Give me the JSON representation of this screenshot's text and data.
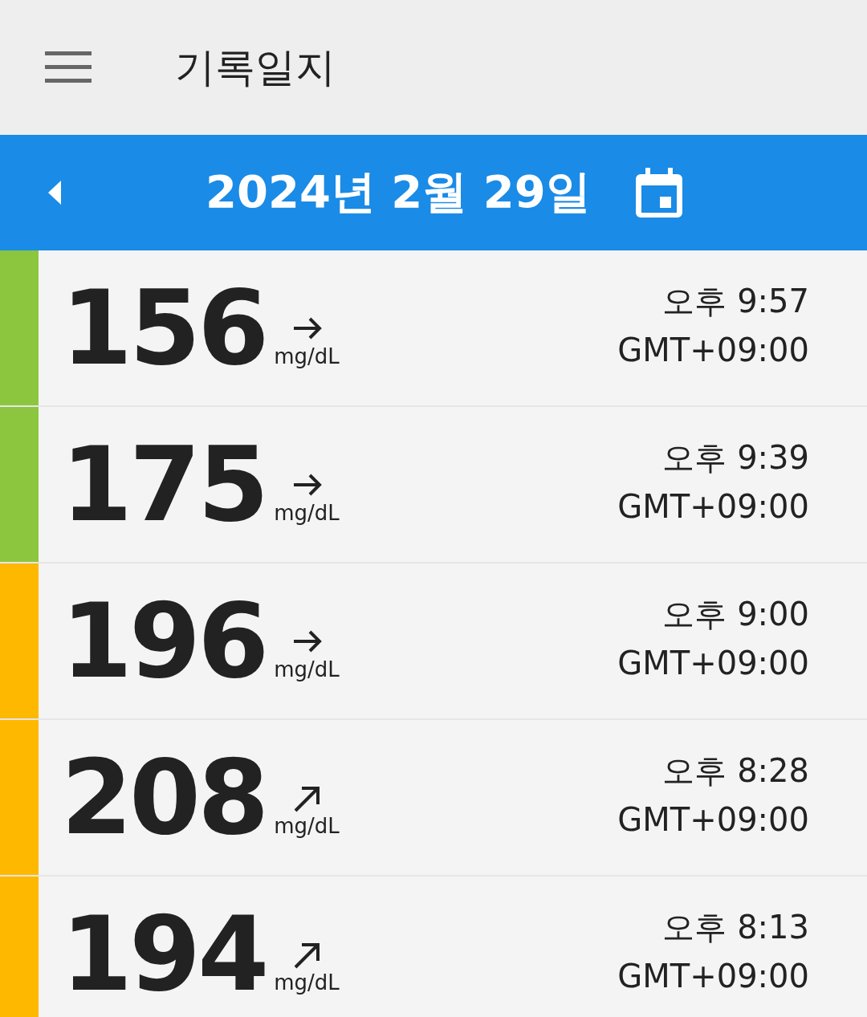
{
  "app_bar": {
    "title": "기록일지"
  },
  "date_bar": {
    "date": "2024년 2월 29일"
  },
  "readings": [
    {
      "value": "156",
      "unit": "mg/dL",
      "kind": "right",
      "color": "#8cc63f",
      "time": "오후 9:57",
      "zone": "GMT+09:00"
    },
    {
      "value": "175",
      "unit": "mg/dL",
      "kind": "right",
      "color": "#8cc63f",
      "time": "오후 9:39",
      "zone": "GMT+09:00"
    },
    {
      "value": "196",
      "unit": "mg/dL",
      "kind": "right",
      "color": "#ffb800",
      "time": "오후 9:00",
      "zone": "GMT+09:00"
    },
    {
      "value": "208",
      "unit": "mg/dL",
      "kind": "up-right",
      "color": "#ffb800",
      "time": "오후 8:28",
      "zone": "GMT+09:00"
    },
    {
      "value": "194",
      "unit": "mg/dL",
      "kind": "up-right",
      "color": "#ffb800",
      "time": "오후 8:13",
      "zone": "GMT+09:00"
    }
  ]
}
